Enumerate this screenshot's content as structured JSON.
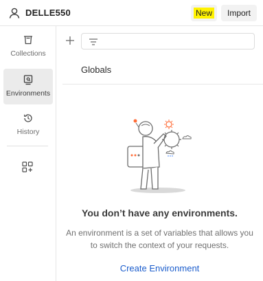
{
  "workspace": {
    "name": "DELLE550",
    "icon": "user-icon"
  },
  "header": {
    "new_label": "New",
    "import_label": "Import",
    "highlight_color": "#fff200"
  },
  "sidebar": {
    "items": [
      {
        "label": "Collections",
        "icon": "collections-icon"
      },
      {
        "label": "Environments",
        "icon": "environments-icon",
        "active": true
      },
      {
        "label": "History",
        "icon": "history-icon"
      }
    ],
    "extra_icon": "add-workbench-icon"
  },
  "main": {
    "globals_label": "Globals",
    "empty_title": "You don’t have any environments.",
    "empty_desc": "An environment is a set of variables that allows you to switch the context of your requests.",
    "create_label": "Create Environment",
    "link_color": "#1a5ccc"
  }
}
